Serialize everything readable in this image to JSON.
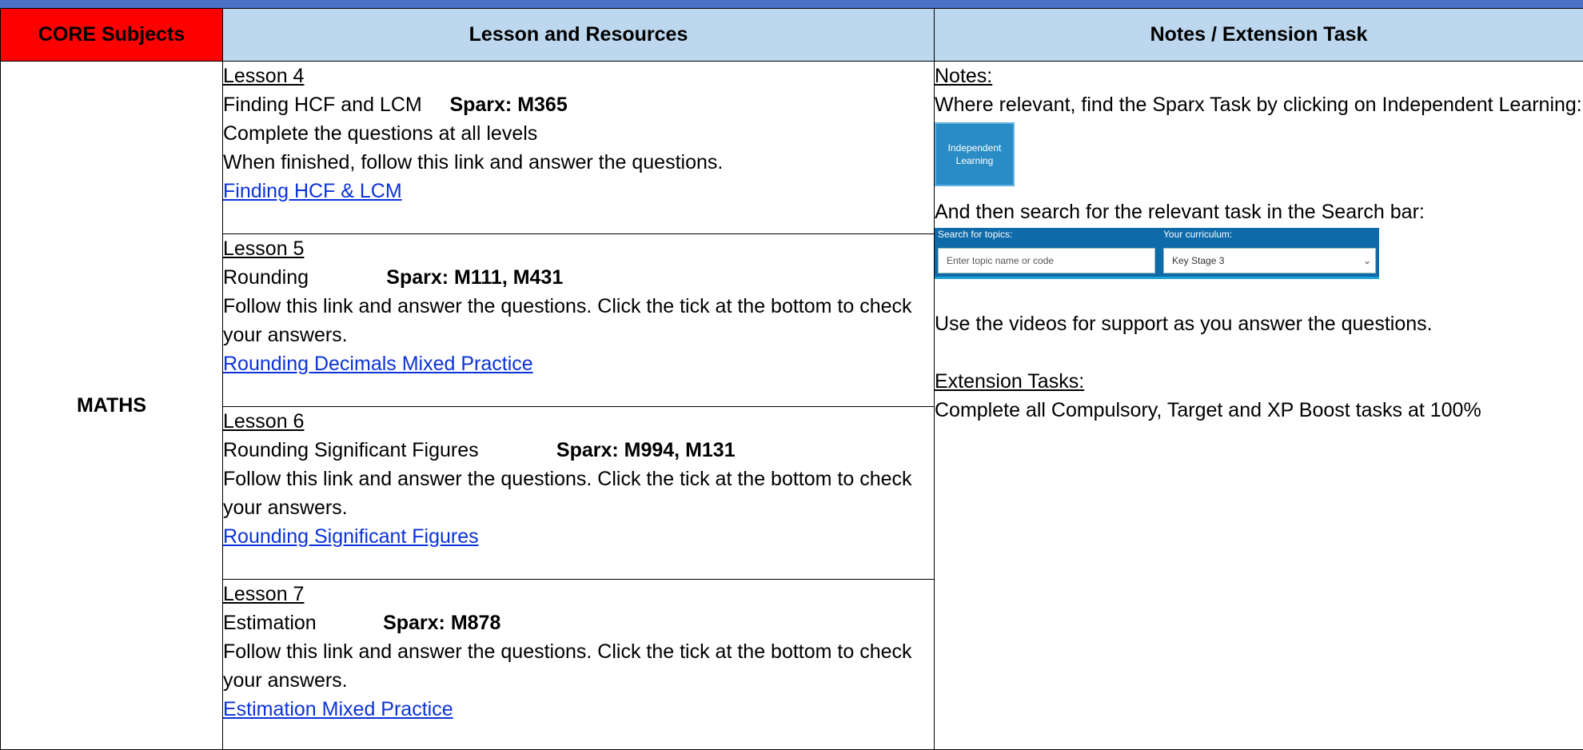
{
  "header": {
    "core_subjects": "CORE Subjects",
    "lesson_resources": "Lesson and Resources",
    "notes_extension": "Notes / Extension Task"
  },
  "subject": "MATHS",
  "lessons": [
    {
      "title": "Lesson 4",
      "topic": "Finding HCF and LCM",
      "sparx": "Sparx: M365",
      "lines": [
        "Complete the questions at all levels",
        "When finished, follow this link and answer the questions."
      ],
      "link": "Finding HCF & LCM"
    },
    {
      "title": "Lesson 5",
      "topic": "Rounding",
      "sparx": "Sparx: M111, M431",
      "lines": [
        "Follow this link and answer the questions. Click the tick at the bottom to check your answers."
      ],
      "link": "Rounding Decimals Mixed Practice"
    },
    {
      "title": "Lesson 6",
      "topic": "Rounding Significant Figures",
      "sparx": "Sparx: M994, M131",
      "lines": [
        "Follow this link and answer the questions. Click the tick at the bottom to check your answers."
      ],
      "link": "Rounding Significant Figures"
    },
    {
      "title": "Lesson 7",
      "topic": "Estimation",
      "sparx": "Sparx: M878",
      "lines": [
        "Follow this link and answer the questions. Click the tick at the bottom to check your answers."
      ],
      "link": "Estimation Mixed Practice"
    }
  ],
  "notes": {
    "heading": "Notes:",
    "intro": "Where relevant, find the Sparx Task by clicking on Independent Learning:",
    "independent_learning_button": "Independent Learning",
    "search_instruction": "And then search for the relevant task in the Search bar:",
    "search_topics_label": "Search for topics:",
    "search_placeholder": "Enter topic name or code",
    "curriculum_label": "Your curriculum:",
    "curriculum_value": "Key Stage 3",
    "videos": "Use the videos for support as you answer the questions.",
    "extension_heading": "Extension Tasks:",
    "extension_text": "Complete all Compulsory, Target and XP Boost tasks at 100%"
  },
  "colors": {
    "core_header_bg": "#ff0000",
    "header_bg": "#bdd7ee",
    "top_band": "#4a73c7",
    "link": "#0b33d9"
  }
}
